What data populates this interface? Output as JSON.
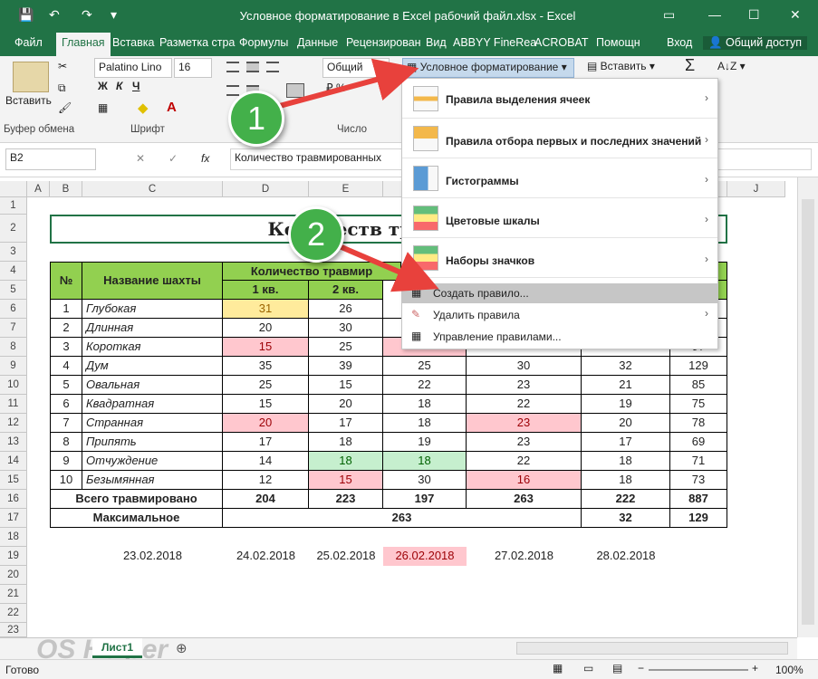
{
  "window": {
    "title": "Условное форматирование в Excel рабочий файл.xlsx - Excel",
    "min": "—",
    "restore": "❐",
    "max": "☐",
    "close": "✕"
  },
  "tabs": [
    "Файл",
    "Главная",
    "Вставка",
    "Разметка стра",
    "Формулы",
    "Данные",
    "Рецензирован",
    "Вид",
    "ABBYY FineRea",
    "ACROBAT",
    "Помощн",
    "Вход",
    "Общий доступ"
  ],
  "ribbon": {
    "paste": "Вставить",
    "font_name": "Palatino Lino",
    "font_size": "16",
    "number_format": "Общий",
    "cond_format": "Условное форматирование",
    "insert": "Вставить",
    "sigma": "Σ",
    "groups": {
      "clipboard": "Буфер обмена",
      "font": "Шрифт",
      "number": "Число"
    },
    "bold": "Ж",
    "italic": "К",
    "underline": "Ч"
  },
  "formula_bar": {
    "name_box": "B2",
    "cancel": "✕",
    "enter": "✓",
    "fx": "fx",
    "content": "Количество травмированных"
  },
  "columns": [
    "A",
    "B",
    "C",
    "D",
    "E",
    "F",
    "G",
    "H",
    "I",
    "J"
  ],
  "rows": [
    "1",
    "2",
    "3",
    "4",
    "5",
    "6",
    "7",
    "8",
    "9",
    "10",
    "11",
    "12",
    "13",
    "14",
    "15",
    "16",
    "17",
    "18",
    "19",
    "20",
    "21",
    "22",
    "23"
  ],
  "table": {
    "title": "Количеств     трав      миров",
    "h_no": "№",
    "h_name": "Название шахты",
    "h_count": "Количество травмир",
    "h_q1": "1 кв.",
    "h_q2": "2 кв.",
    "h_last": "а",
    "data": [
      {
        "n": "1",
        "name": "Глубокая",
        "q1": "31",
        "q2": "26",
        "q3": "",
        "q4": "",
        "q5": "",
        "tot": ""
      },
      {
        "n": "2",
        "name": "Длинная",
        "q1": "20",
        "q2": "30",
        "q3": "",
        "q4": "",
        "q5": "",
        "tot": ""
      },
      {
        "n": "3",
        "name": "Короткая",
        "q1": "15",
        "q2": "25",
        "q3": "",
        "q4": "",
        "q5": "",
        "tot": "97"
      },
      {
        "n": "4",
        "name": "Дум",
        "q1": "35",
        "q2": "39",
        "q3": "25",
        "q4": "30",
        "q5": "32",
        "tot": "129"
      },
      {
        "n": "5",
        "name": "Овальная",
        "q1": "25",
        "q2": "15",
        "q3": "22",
        "q4": "23",
        "q5": "21",
        "tot": "85"
      },
      {
        "n": "6",
        "name": "Квадратная",
        "q1": "15",
        "q2": "20",
        "q3": "18",
        "q4": "22",
        "q5": "19",
        "tot": "75"
      },
      {
        "n": "7",
        "name": "Странная",
        "q1": "20",
        "q2": "17",
        "q3": "18",
        "q4": "23",
        "q5": "20",
        "tot": "78"
      },
      {
        "n": "8",
        "name": "Припять",
        "q1": "17",
        "q2": "18",
        "q3": "19",
        "q4": "23",
        "q5": "17",
        "tot": "69"
      },
      {
        "n": "9",
        "name": "Отчуждение",
        "q1": "14",
        "q2": "18",
        "q3": "18",
        "q4": "22",
        "q5": "18",
        "tot": "71"
      },
      {
        "n": "10",
        "name": "Безымянная",
        "q1": "12",
        "q2": "15",
        "q3": "30",
        "q4": "16",
        "q5": "18",
        "tot": "73"
      }
    ],
    "total_label": "Всего травмировано",
    "totals": [
      "204",
      "223",
      "197",
      "263",
      "222",
      "887"
    ],
    "max_label": "Максимальное",
    "max_vals": [
      "263",
      "32",
      "129"
    ],
    "dates": [
      "23.02.2018",
      "24.02.2018",
      "25.02.2018",
      "26.02.2018",
      "27.02.2018",
      "28.02.2018"
    ]
  },
  "menu": {
    "items": [
      "Правила выделения ячеек",
      "Правила отбора первых и последних значений",
      "Гистограммы",
      "Цветовые шкалы",
      "Наборы значков"
    ],
    "small": [
      "Создать правило...",
      "Удалить правила",
      "Управление правилами..."
    ],
    "arrow": "›"
  },
  "annotations": {
    "step1": "1",
    "step2": "2"
  },
  "sheet": {
    "tab": "Лист1",
    "add": "⊕",
    "watermark": "OS Helper"
  },
  "status": {
    "ready": "Готово",
    "zoom": "100%",
    "minus": "−",
    "plus": "+"
  }
}
